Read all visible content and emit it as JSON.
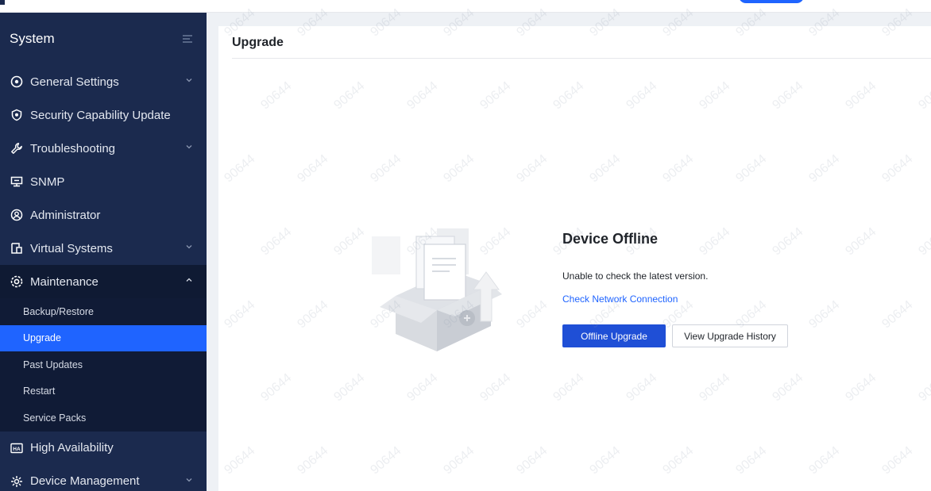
{
  "sidebar": {
    "title": "System",
    "items": [
      {
        "label": "General Settings",
        "icon": "gear-circle-icon",
        "chevron": "down"
      },
      {
        "label": "Security Capability Update",
        "icon": "shield-icon",
        "chevron": ""
      },
      {
        "label": "Troubleshooting",
        "icon": "wrench-icon",
        "chevron": "down"
      },
      {
        "label": "SNMP",
        "icon": "network-icon",
        "chevron": ""
      },
      {
        "label": "Administrator",
        "icon": "user-icon",
        "chevron": ""
      },
      {
        "label": "Virtual Systems",
        "icon": "virtual-icon",
        "chevron": "down"
      },
      {
        "label": "Maintenance",
        "icon": "maintenance-icon",
        "chevron": "up"
      }
    ],
    "subitems": [
      {
        "label": "Backup/Restore",
        "active": false
      },
      {
        "label": "Upgrade",
        "active": true
      },
      {
        "label": "Past Updates",
        "active": false
      },
      {
        "label": "Restart",
        "active": false
      },
      {
        "label": "Service Packs",
        "active": false
      }
    ],
    "items_after": [
      {
        "label": "High Availability",
        "icon": "ha-icon",
        "chevron": ""
      },
      {
        "label": "Device Management",
        "icon": "device-management-icon",
        "chevron": "down"
      }
    ]
  },
  "main": {
    "title": "Upgrade",
    "status_title": "Device Offline",
    "status_message": "Unable to check the latest version.",
    "check_link": "Check Network Connection",
    "primary_button": "Offline Upgrade",
    "secondary_button": "View Upgrade History"
  },
  "watermark": "90644",
  "colors": {
    "sidebar_bg": "#1b2a4e",
    "accent": "#1f64ff",
    "primary_button": "#1f4fd6"
  }
}
